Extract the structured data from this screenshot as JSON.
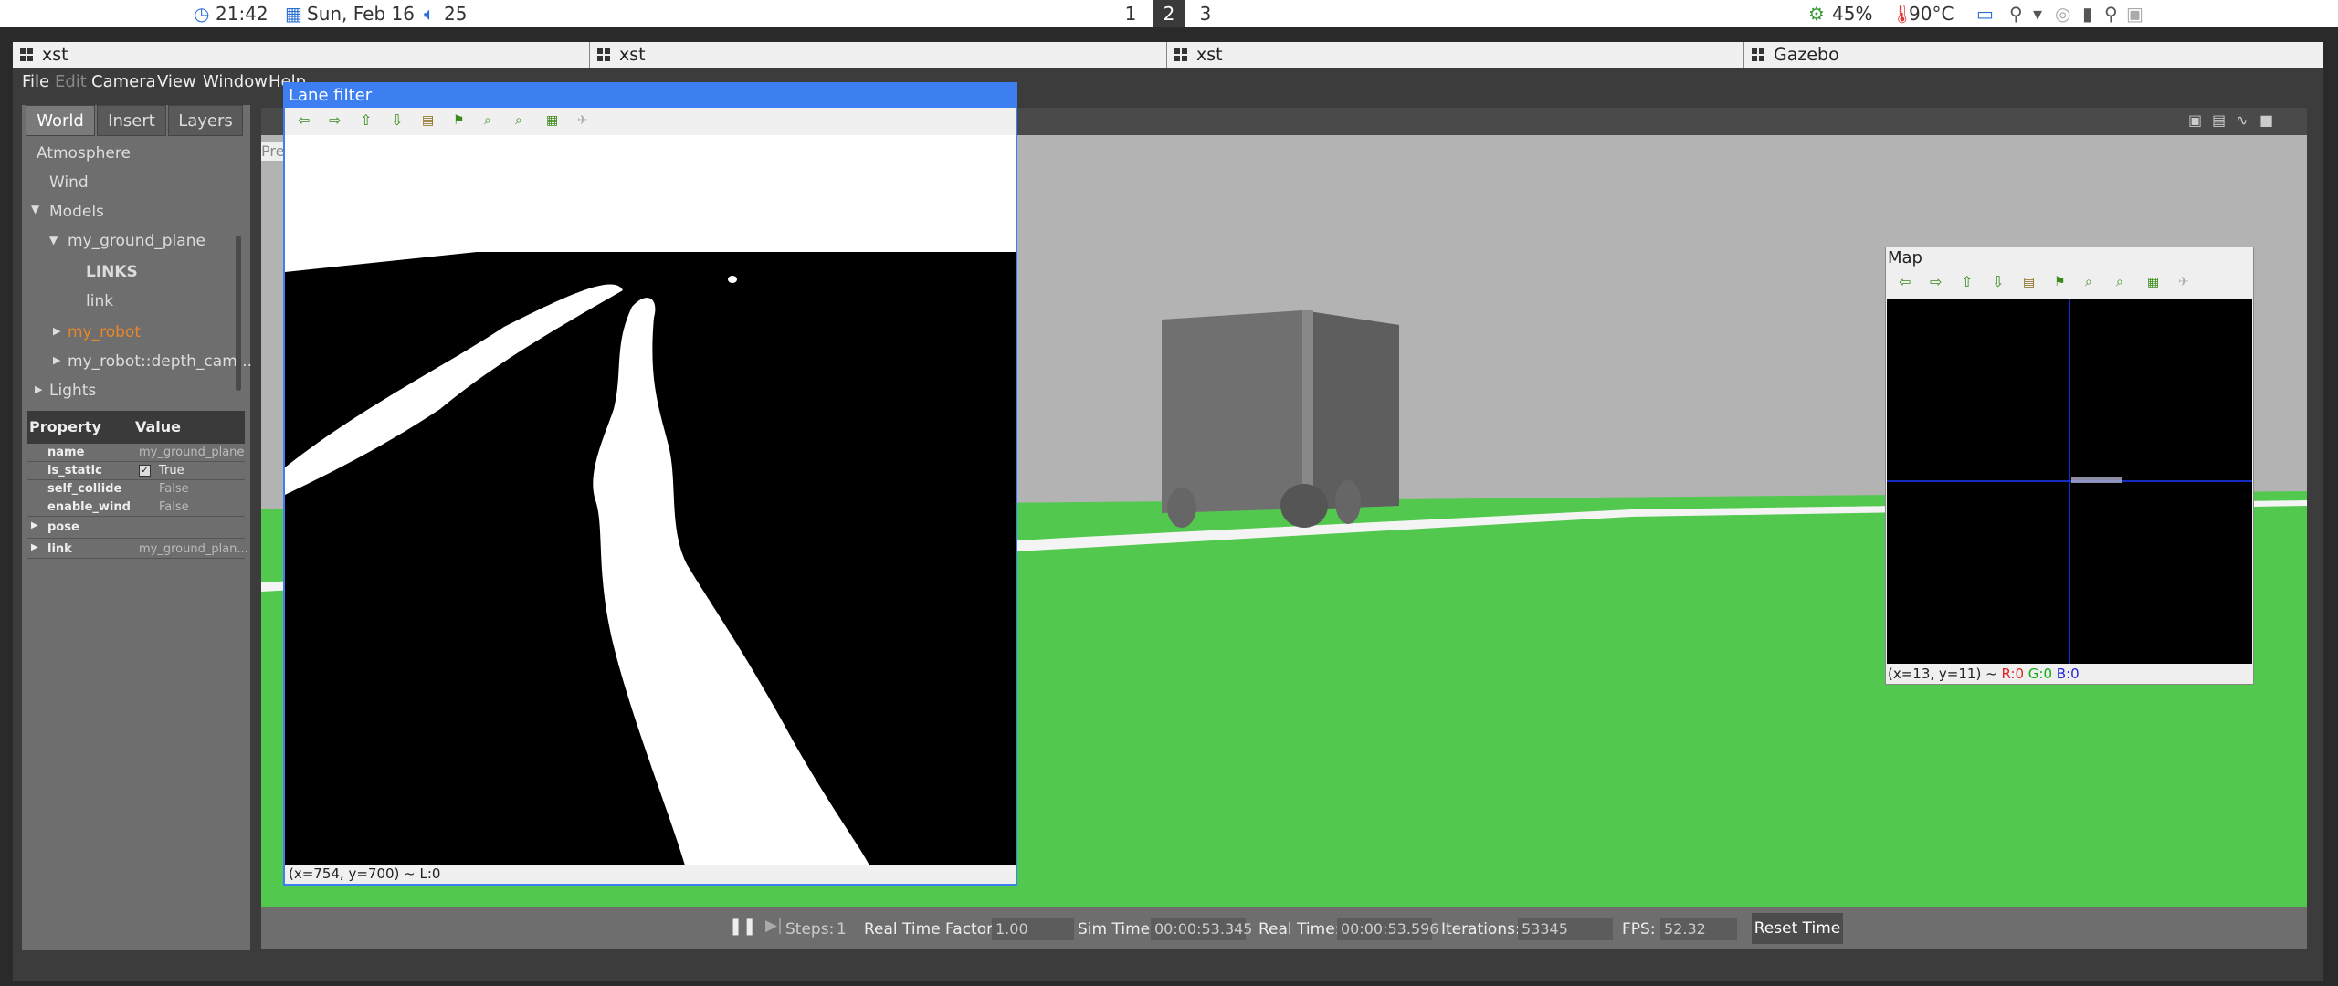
{
  "topbar": {
    "time": "21:42",
    "date": "Sun, Feb 16",
    "volume": "25",
    "workspaces": [
      "1",
      "2",
      "3"
    ],
    "active_workspace": "2",
    "cpu": "45%",
    "temp": "90°C"
  },
  "taskbar": {
    "tasks": [
      "xst",
      "xst",
      "xst",
      "Gazebo"
    ]
  },
  "menubar": {
    "items": [
      "File",
      "Edit",
      "Camera",
      "View",
      "Window",
      "Help"
    ]
  },
  "tabs": [
    "World",
    "Insert",
    "Layers"
  ],
  "tree": {
    "atmosphere": "Atmosphere",
    "wind": "Wind",
    "models": "Models",
    "ground_plane": "my_ground_plane",
    "links": "LINKS",
    "link": "link",
    "robot": "my_robot",
    "depth_cam": "my_robot::depth_cam...",
    "lights": "Lights"
  },
  "properties": {
    "header_property": "Property",
    "header_value": "Value",
    "rows": [
      {
        "name": "name",
        "value": "my_ground_plane"
      },
      {
        "name": "is_static",
        "value": "True"
      },
      {
        "name": "self_collide",
        "value": "False"
      },
      {
        "name": "enable_wind",
        "value": "False"
      }
    ],
    "pose": "pose",
    "link": "link",
    "link_value": "my_ground_plan..."
  },
  "viewport_partial": "Pre",
  "lane_filter": {
    "title": "Lane filter",
    "status": "(x=754, y=700) ~ L:0"
  },
  "map": {
    "title": "Map",
    "status_prefix": "(x=13, y=11) ~",
    "r": "R:0",
    "g": "G:0",
    "b": "B:0"
  },
  "bottom": {
    "steps_label": "Steps:",
    "steps": "1",
    "rtf_label": "Real Time Factor:",
    "rtf": "1.00",
    "sim_label": "Sim Time:",
    "sim": "00:00:53.345",
    "real_label": "Real Time:",
    "real": "00:00:53.596",
    "iter_label": "Iterations:",
    "iter": "53345",
    "fps_label": "FPS:",
    "fps": "52.32",
    "reset": "Reset Time"
  },
  "colors": {
    "accent": "#3d7ef0",
    "ground": "#53c84e",
    "robot_label": "#e8862a"
  }
}
